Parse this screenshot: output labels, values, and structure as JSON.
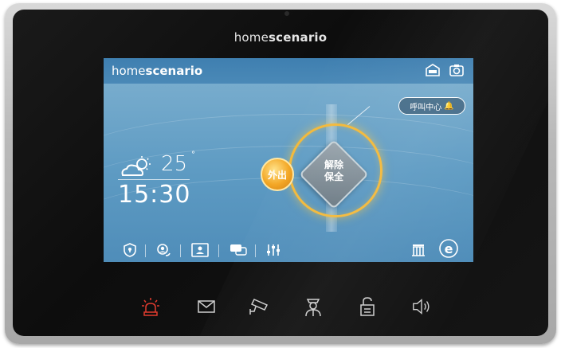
{
  "device": {
    "brand_regular": "home",
    "brand_bold": "scenario"
  },
  "screen": {
    "logo_regular": "home",
    "logo_bold": "scenario",
    "top_icons": [
      "car-garage-icon",
      "camera-icon"
    ],
    "weather": {
      "condition_icon": "partly-cloudy-icon",
      "temperature": "25",
      "degree_symbol": "°",
      "time": "15:30"
    },
    "security": {
      "away_label": "外出",
      "disarm_label_line1": "解除",
      "disarm_label_line2": "保全"
    },
    "call_center_label": "呼叫中心",
    "bottom_icons": [
      "shield-icon",
      "user-service-icon",
      "contact-card-icon",
      "message-icon",
      "settings-sliders-icon",
      "building-icon",
      "ie-icon"
    ]
  },
  "hardware_keys": [
    "sos-alarm-icon",
    "mail-icon",
    "cctv-camera-icon",
    "guard-icon",
    "unlock-icon",
    "speaker-icon"
  ],
  "colors": {
    "accent_ring": "#f3b93a",
    "away_button": "#f3a623",
    "sos_red": "#e23b2f",
    "screen_blue": "#5e9bc3"
  }
}
